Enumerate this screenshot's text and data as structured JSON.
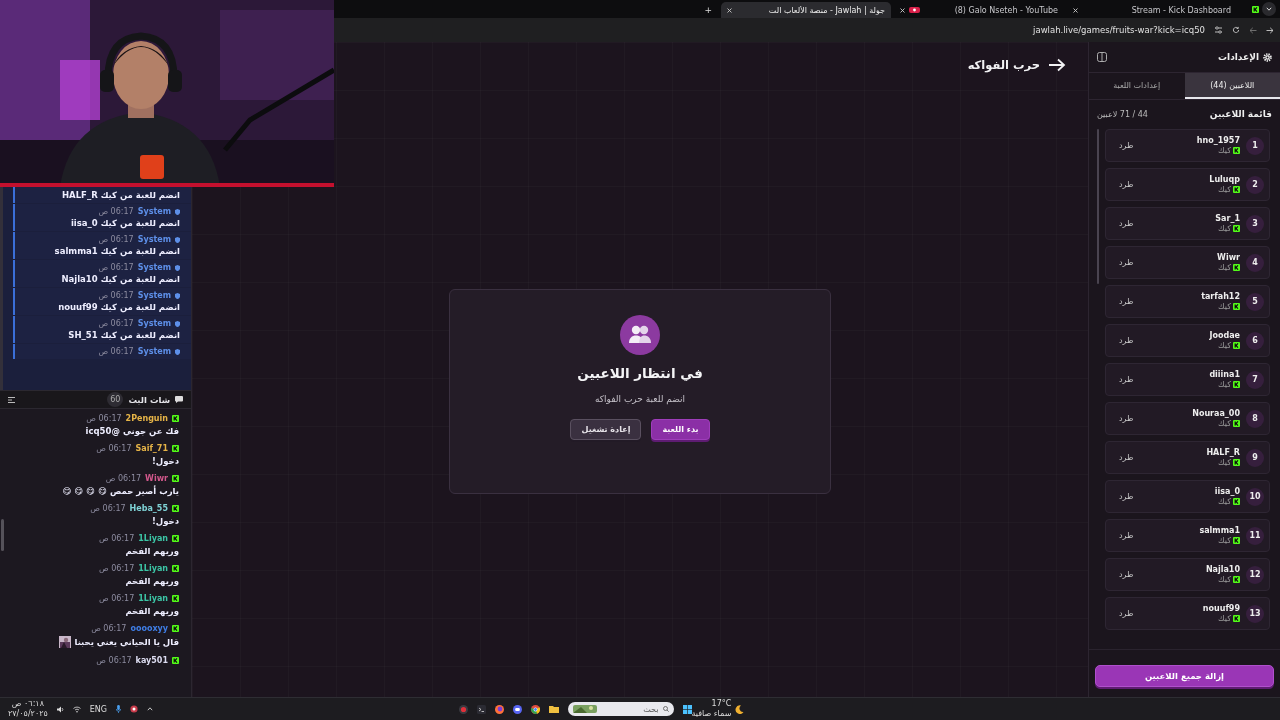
{
  "browser": {
    "tabs": [
      {
        "title": "Stream - Kick Dashboard",
        "selected": false,
        "playing": false
      },
      {
        "title": "(8) Galo Nseteh - YouTube",
        "selected": false,
        "playing": true
      },
      {
        "title": "جولة | Jawlah - منصة الألعاب الت",
        "selected": true,
        "playing": false
      }
    ],
    "new_tab": "+",
    "address": "jawlah.live/games/fruits-war?kick=icq50"
  },
  "system_messages": [
    {
      "text": "HALF_R انضم للعبة من كيك"
    },
    {
      "sender": "System",
      "time": "06:17 ص",
      "text": "iisa_0 انضم للعبة من كيك"
    },
    {
      "sender": "System",
      "time": "06:17 ص",
      "text": "salmma1 انضم للعبة من كيك"
    },
    {
      "sender": "System",
      "time": "06:17 ص",
      "text": "Najla10 انضم للعبة من كيك"
    },
    {
      "sender": "System",
      "time": "06:17 ص",
      "text": "nouuf99 انضم للعبة من كيك"
    },
    {
      "sender": "System",
      "time": "06:17 ص",
      "text": "SH_51 انضم للعبة من كيك"
    },
    {
      "sender": "System",
      "time": "06:17 ص"
    }
  ],
  "chat": {
    "title": "شات البث",
    "count": "60",
    "messages": [
      {
        "user": "2Penguin",
        "color": "#e6b447",
        "time": "06:17 ص",
        "text": "فك عن جوني @icq50"
      },
      {
        "user": "Saif_71",
        "color": "#e6b447",
        "time": "06:17 ص",
        "text": "دخول!"
      },
      {
        "user": "Wiwr",
        "color": "#d2588c",
        "time": "06:17 ص",
        "text": "يارب أصير حمص 😋 😋 😋 😋"
      },
      {
        "user": "Heba_55",
        "color": "#7fd3d6",
        "time": "06:17 ص",
        "text": "دخول!"
      },
      {
        "user": "1Liyan",
        "color": "#3cc6a6",
        "time": "06:17 ص",
        "text": "وريهم الفخم"
      },
      {
        "user": "1Liyan",
        "color": "#3cc6a6",
        "time": "06:17 ص",
        "text": "وريهم الفخم"
      },
      {
        "user": "1Liyan",
        "color": "#3cc6a6",
        "time": "06:17 ص",
        "text": "وريهم الفخم"
      },
      {
        "user": "ooooxyy",
        "color": "#3f7ee6",
        "time": "06:17 ص",
        "text": "قال يا الحياني يعني يحبنا"
      },
      {
        "user": "kay501",
        "color": "#dcdcf0",
        "time": "06:17 ص"
      }
    ]
  },
  "game": {
    "title": "حرب الفواكه",
    "status_title": "في انتظار اللاعبين",
    "status_text": "انضم للعبة حرب الفواكه",
    "buttons": [
      {
        "label": "بدء اللعبة",
        "kind": "primary"
      },
      {
        "label": "إعادة تشغيل",
        "kind": "secondary"
      }
    ]
  },
  "sidebar": {
    "title": "الإعدادات",
    "tabs": [
      {
        "label": "اللاعبين (44)",
        "selected": true
      },
      {
        "label": "إعدادات اللعبة",
        "selected": false
      }
    ],
    "list_title": "قائمة اللاعبين",
    "list_count": "44 / 71 لاعبين",
    "players": [
      {
        "rank": "1",
        "name": "hno_1957",
        "platform": "كيك",
        "action": "طرد"
      },
      {
        "rank": "2",
        "name": "Luluqp",
        "platform": "كيك",
        "action": "طرد"
      },
      {
        "rank": "3",
        "name": "Sar_1",
        "platform": "كيك",
        "action": "طرد"
      },
      {
        "rank": "4",
        "name": "Wiwr",
        "platform": "كيك",
        "action": "طرد"
      },
      {
        "rank": "5",
        "name": "tarfah12",
        "platform": "كيك",
        "action": "طرد"
      },
      {
        "rank": "6",
        "name": "Joodae",
        "platform": "كيك",
        "action": "طرد"
      },
      {
        "rank": "7",
        "name": "diiina1",
        "platform": "كيك",
        "action": "طرد"
      },
      {
        "rank": "8",
        "name": "Nouraa_00",
        "platform": "كيك",
        "action": "طرد"
      },
      {
        "rank": "9",
        "name": "HALF_R",
        "platform": "كيك",
        "action": "طرد"
      },
      {
        "rank": "10",
        "name": "iisa_0",
        "platform": "كيك",
        "action": "طرد"
      },
      {
        "rank": "11",
        "name": "salmma1",
        "platform": "كيك",
        "action": "طرد"
      },
      {
        "rank": "12",
        "name": "Najla10",
        "platform": "كيك",
        "action": "طرد"
      },
      {
        "rank": "13",
        "name": "nouuf99",
        "platform": "كيك",
        "action": "طرد"
      }
    ],
    "remove_all": "إزالة جميع اللاعبين"
  },
  "taskbar": {
    "time": "٠٦:١٨ ص",
    "date": "٢٧/٠٥/٢٠٢٥",
    "language": "ENG",
    "search_placeholder": "بحث",
    "weather": {
      "temperature": "17°C",
      "condition": "سماء صافية"
    }
  }
}
